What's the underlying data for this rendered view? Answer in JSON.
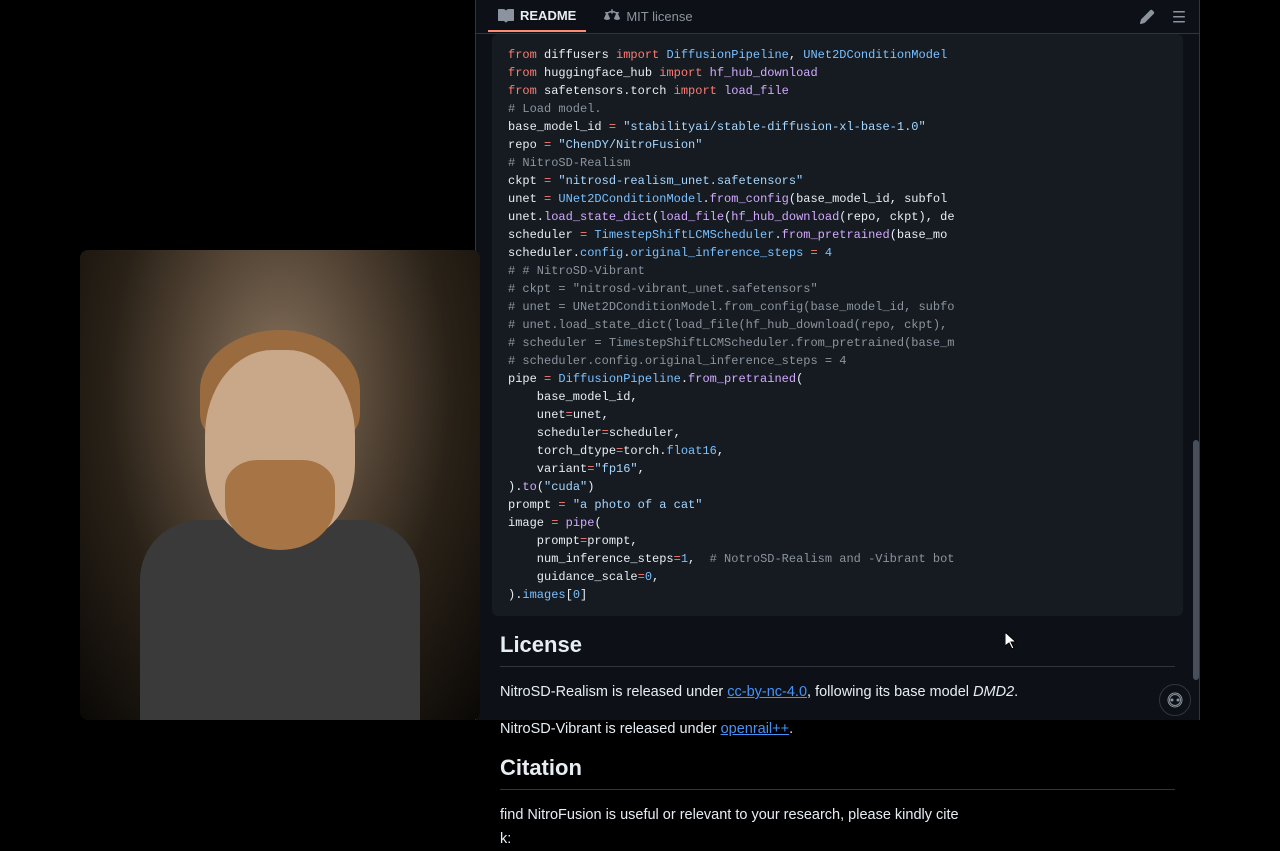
{
  "tabs": {
    "readme": "README",
    "license": "MIT license"
  },
  "code": {
    "lines": [
      {
        "t": "code",
        "tokens": [
          [
            "kw",
            "from"
          ],
          [
            "",
            " diffusers "
          ],
          [
            "kw",
            "import"
          ],
          [
            "",
            " "
          ],
          [
            "cls",
            "DiffusionPipeline"
          ],
          [
            "",
            ", "
          ],
          [
            "cls",
            "UNet2DConditionModel"
          ]
        ]
      },
      {
        "t": "code",
        "tokens": [
          [
            "kw",
            "from"
          ],
          [
            "",
            " huggingface_hub "
          ],
          [
            "kw",
            "import"
          ],
          [
            "",
            " "
          ],
          [
            "fn",
            "hf_hub_download"
          ]
        ]
      },
      {
        "t": "code",
        "tokens": [
          [
            "kw",
            "from"
          ],
          [
            "",
            " safetensors.torch "
          ],
          [
            "kw",
            "import"
          ],
          [
            "",
            " "
          ],
          [
            "fn",
            "load_file"
          ]
        ]
      },
      {
        "t": "code",
        "tokens": [
          [
            "cmt",
            "# Load model."
          ]
        ]
      },
      {
        "t": "code",
        "tokens": [
          [
            "",
            "base_model_id "
          ],
          [
            "op",
            "="
          ],
          [
            "",
            " "
          ],
          [
            "str",
            "\"stabilityai/stable-diffusion-xl-base-1.0\""
          ]
        ]
      },
      {
        "t": "code",
        "tokens": [
          [
            "",
            "repo "
          ],
          [
            "op",
            "="
          ],
          [
            "",
            " "
          ],
          [
            "str",
            "\"ChenDY/NitroFusion\""
          ]
        ]
      },
      {
        "t": "code",
        "tokens": [
          [
            "cmt",
            "# NitroSD-Realism"
          ]
        ]
      },
      {
        "t": "code",
        "tokens": [
          [
            "",
            "ckpt "
          ],
          [
            "op",
            "="
          ],
          [
            "",
            " "
          ],
          [
            "str",
            "\"nitrosd-realism_unet.safetensors\""
          ]
        ]
      },
      {
        "t": "code",
        "tokens": [
          [
            "",
            "unet "
          ],
          [
            "op",
            "="
          ],
          [
            "",
            " "
          ],
          [
            "cls",
            "UNet2DConditionModel"
          ],
          [
            "",
            "."
          ],
          [
            "fn",
            "from_config"
          ],
          [
            "",
            "(base_model_id, subfol"
          ]
        ]
      },
      {
        "t": "code",
        "tokens": [
          [
            "",
            "unet."
          ],
          [
            "fn",
            "load_state_dict"
          ],
          [
            "",
            "("
          ],
          [
            "fn",
            "load_file"
          ],
          [
            "",
            "("
          ],
          [
            "fn",
            "hf_hub_download"
          ],
          [
            "",
            "(repo, ckpt), de"
          ]
        ]
      },
      {
        "t": "code",
        "tokens": [
          [
            "",
            "scheduler "
          ],
          [
            "op",
            "="
          ],
          [
            "",
            " "
          ],
          [
            "cls",
            "TimestepShiftLCMScheduler"
          ],
          [
            "",
            "."
          ],
          [
            "fn",
            "from_pretrained"
          ],
          [
            "",
            "(base_mo"
          ]
        ]
      },
      {
        "t": "code",
        "tokens": [
          [
            "",
            "scheduler."
          ],
          [
            "prop",
            "config"
          ],
          [
            "",
            "."
          ],
          [
            "prop",
            "original_inference_steps"
          ],
          [
            "",
            " "
          ],
          [
            "op",
            "="
          ],
          [
            "",
            " "
          ],
          [
            "num",
            "4"
          ]
        ]
      },
      {
        "t": "code",
        "tokens": [
          [
            "cmt",
            "# # NitroSD-Vibrant"
          ]
        ]
      },
      {
        "t": "code",
        "tokens": [
          [
            "cmt",
            "# ckpt = \"nitrosd-vibrant_unet.safetensors\""
          ]
        ]
      },
      {
        "t": "code",
        "tokens": [
          [
            "cmt",
            "# unet = UNet2DConditionModel.from_config(base_model_id, subfo"
          ]
        ]
      },
      {
        "t": "code",
        "tokens": [
          [
            "cmt",
            "# unet.load_state_dict(load_file(hf_hub_download(repo, ckpt),"
          ]
        ]
      },
      {
        "t": "code",
        "tokens": [
          [
            "cmt",
            "# scheduler = TimestepShiftLCMScheduler.from_pretrained(base_m"
          ]
        ]
      },
      {
        "t": "code",
        "tokens": [
          [
            "cmt",
            "# scheduler.config.original_inference_steps = 4"
          ]
        ]
      },
      {
        "t": "code",
        "tokens": [
          [
            "",
            "pipe "
          ],
          [
            "op",
            "="
          ],
          [
            "",
            " "
          ],
          [
            "cls",
            "DiffusionPipeline"
          ],
          [
            "",
            "."
          ],
          [
            "fn",
            "from_pretrained"
          ],
          [
            "",
            "("
          ]
        ]
      },
      {
        "t": "code",
        "tokens": [
          [
            "",
            "    base_model_id,"
          ]
        ]
      },
      {
        "t": "code",
        "tokens": [
          [
            "",
            "    unet"
          ],
          [
            "op",
            "="
          ],
          [
            "",
            "unet,"
          ]
        ]
      },
      {
        "t": "code",
        "tokens": [
          [
            "",
            "    scheduler"
          ],
          [
            "op",
            "="
          ],
          [
            "",
            "scheduler,"
          ]
        ]
      },
      {
        "t": "code",
        "tokens": [
          [
            "",
            "    torch_dtype"
          ],
          [
            "op",
            "="
          ],
          [
            "",
            "torch."
          ],
          [
            "prop",
            "float16"
          ],
          [
            "",
            ","
          ]
        ]
      },
      {
        "t": "code",
        "tokens": [
          [
            "",
            "    variant"
          ],
          [
            "op",
            "="
          ],
          [
            "str",
            "\"fp16\""
          ],
          [
            "",
            ","
          ]
        ]
      },
      {
        "t": "code",
        "tokens": [
          [
            "",
            ")."
          ],
          [
            "fn",
            "to"
          ],
          [
            "",
            "("
          ],
          [
            "str",
            "\"cuda\""
          ],
          [
            "",
            ")"
          ]
        ]
      },
      {
        "t": "code",
        "tokens": [
          [
            "",
            "prompt "
          ],
          [
            "op",
            "="
          ],
          [
            "",
            " "
          ],
          [
            "str",
            "\"a photo of a cat\""
          ]
        ]
      },
      {
        "t": "code",
        "tokens": [
          [
            "",
            "image "
          ],
          [
            "op",
            "="
          ],
          [
            "",
            " "
          ],
          [
            "fn",
            "pipe"
          ],
          [
            "",
            "("
          ]
        ]
      },
      {
        "t": "code",
        "tokens": [
          [
            "",
            "    prompt"
          ],
          [
            "op",
            "="
          ],
          [
            "",
            "prompt,"
          ]
        ]
      },
      {
        "t": "code",
        "tokens": [
          [
            "",
            "    num_inference_steps"
          ],
          [
            "op",
            "="
          ],
          [
            "num",
            "1"
          ],
          [
            "",
            ",  "
          ],
          [
            "cmt",
            "# NotroSD-Realism and -Vibrant bot"
          ]
        ]
      },
      {
        "t": "code",
        "tokens": [
          [
            "",
            "    guidance_scale"
          ],
          [
            "op",
            "="
          ],
          [
            "num",
            "0"
          ],
          [
            "",
            ","
          ]
        ]
      },
      {
        "t": "code",
        "tokens": [
          [
            "",
            ")."
          ],
          [
            "prop",
            "images"
          ],
          [
            "",
            "["
          ],
          [
            "num",
            "0"
          ],
          [
            "",
            "]"
          ]
        ]
      }
    ]
  },
  "license": {
    "heading": "License",
    "realism_pre": "NitroSD-Realism is released under ",
    "realism_link": "cc-by-nc-4.0",
    "realism_post": ", following its base model ",
    "realism_em": "DMD2",
    "realism_end": ".",
    "vibrant_pre": "NitroSD-Vibrant is released under ",
    "vibrant_link": "openrail++",
    "vibrant_end": "."
  },
  "citation": {
    "heading": "Citation",
    "text_mid": "find NitroFusion is useful or relevant to your research, please kindly cite",
    "text_end": "k:"
  }
}
